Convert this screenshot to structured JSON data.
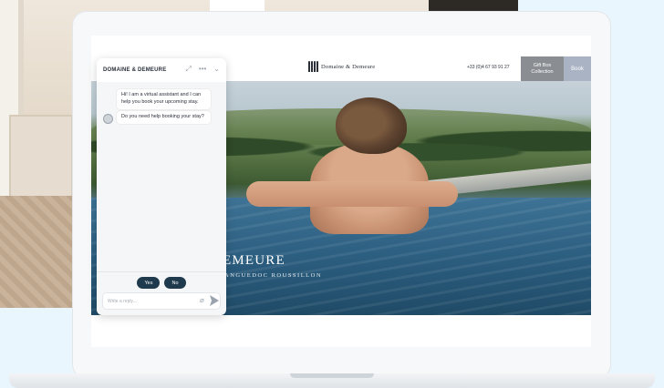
{
  "site": {
    "logo_text": "Domaine & Demeure",
    "phone": "+33 (0)4 67 93 91 27",
    "gift_button": "Gift Box Collection",
    "book_button": "Book",
    "hero_title": "EMEURE",
    "hero_subtitle": "ANGUEDOC ROUSSILLON"
  },
  "chat": {
    "title": "DOMAINE & DEMEURE",
    "icons": {
      "expand": "expand-icon",
      "more": "more-options-icon",
      "collapse": "chevron-down-icon"
    },
    "messages": [
      {
        "text": "Hi! I am a virtual assistant and I can help you book your upcoming stay."
      },
      {
        "text": "Do you need help booking your stay?"
      }
    ],
    "replies": {
      "yes": "Yes",
      "no": "No"
    },
    "composer": {
      "placeholder": "Write a reply..."
    }
  },
  "colors": {
    "accent_dark": "#1f3a4d",
    "gift_button_bg": "#8a8d92",
    "book_button_bg": "#a9b3c4"
  }
}
